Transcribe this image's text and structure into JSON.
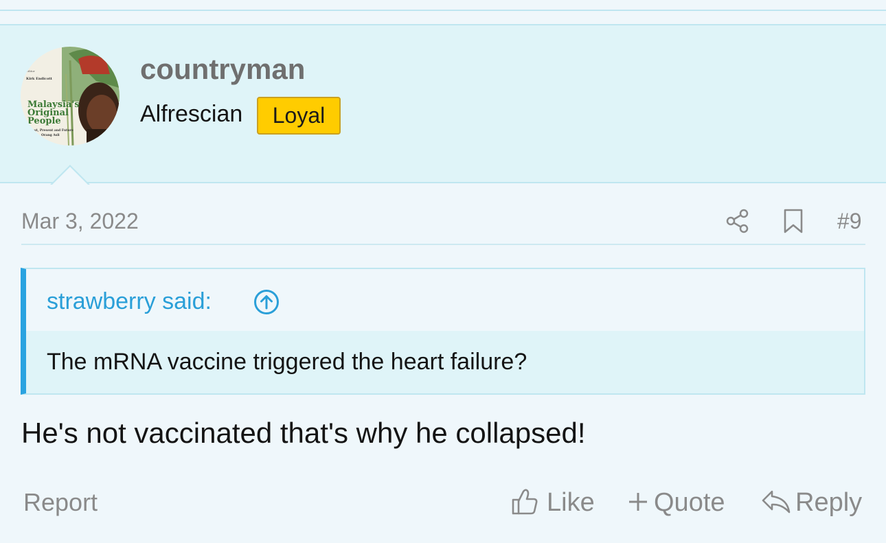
{
  "post": {
    "username": "countryman",
    "user_title": "Alfrescian",
    "badge": "Loyal",
    "avatar_text": {
      "editor": "Editor",
      "author": "Kirk Endicott",
      "title_line1": "Malaysia's",
      "title_line2": "Original",
      "title_line3": "People",
      "subtitle1": "Past, Present and Future",
      "subtitle2": "Orang Asli"
    },
    "date": "Mar 3, 2022",
    "number": "#9",
    "quote": {
      "author": "strawberry said:",
      "text": "The mRNA vaccine triggered the heart failure?"
    },
    "body": "He's not vaccinated that's why he collapsed!",
    "actions": {
      "report": "Report",
      "like": "Like",
      "quote": "Quote",
      "reply": "Reply"
    },
    "icons": [
      "share-icon",
      "bookmark-icon",
      "arrow-up-circle-icon",
      "thumbs-up-icon",
      "plus-icon",
      "reply-icon"
    ]
  },
  "colors": {
    "header_bg": "#dff4f8",
    "page_bg": "#eff7fb",
    "accent": "#2aa3e0",
    "badge": "#ffcc00",
    "muted_text": "#8a8a8a"
  }
}
